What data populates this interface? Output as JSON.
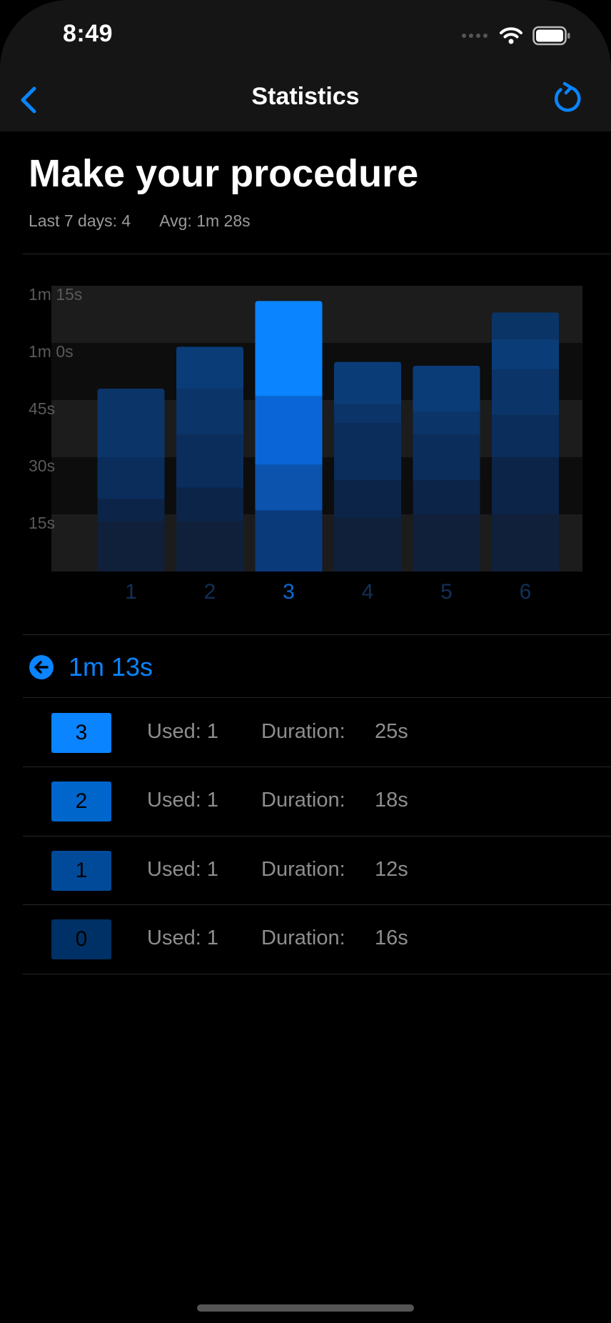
{
  "status_bar": {
    "time": "8:49"
  },
  "nav": {
    "title": "Statistics",
    "back_icon": "chevron-left-icon",
    "refresh_icon": "refresh-icon"
  },
  "header": {
    "title": "Make your procedure",
    "last_days": "Last 7 days: 4",
    "avg": "Avg: 1m 28s"
  },
  "colors": {
    "accent": "#0a84ff",
    "background": "#000000",
    "nav_bar": "#151515",
    "secondary_text": "#8e8e8e"
  },
  "chart_data": {
    "type": "bar",
    "stacked": true,
    "categories": [
      "1",
      "2",
      "3",
      "4",
      "5",
      "6"
    ],
    "selected_category": "3",
    "y_tick_labels": [
      "1m 15s",
      "1m 0s",
      "45s",
      "30s",
      "15s"
    ],
    "y_tick_values": [
      75,
      60,
      45,
      30,
      15
    ],
    "ylim": [
      0,
      75
    ],
    "y_unit": "seconds",
    "grid": "alternating horizontal bands",
    "series_segments_bottom_to_top": [
      [
        13,
        6,
        11,
        18
      ],
      [
        13,
        9,
        14,
        12,
        11
      ],
      [
        16,
        12,
        18,
        25
      ],
      [
        14,
        10,
        15,
        5,
        11
      ],
      [
        15,
        9,
        12,
        6,
        12
      ],
      [
        15,
        15,
        11,
        12,
        8,
        7
      ]
    ]
  },
  "selected": {
    "value": "1m 13s",
    "icon": "arrow-left-circle-icon"
  },
  "detail_rows": [
    {
      "index": "3",
      "used": "Used: 1",
      "duration_label": "Duration:",
      "duration": "25s",
      "color": "#0a84ff"
    },
    {
      "index": "2",
      "used": "Used: 1",
      "duration_label": "Duration:",
      "duration": "18s",
      "color": "#0066cc"
    },
    {
      "index": "1",
      "used": "Used: 1",
      "duration_label": "Duration:",
      "duration": "12s",
      "color": "#004a99"
    },
    {
      "index": "0",
      "used": "Used: 1",
      "duration_label": "Duration:",
      "duration": "16s",
      "color": "#003166"
    }
  ]
}
